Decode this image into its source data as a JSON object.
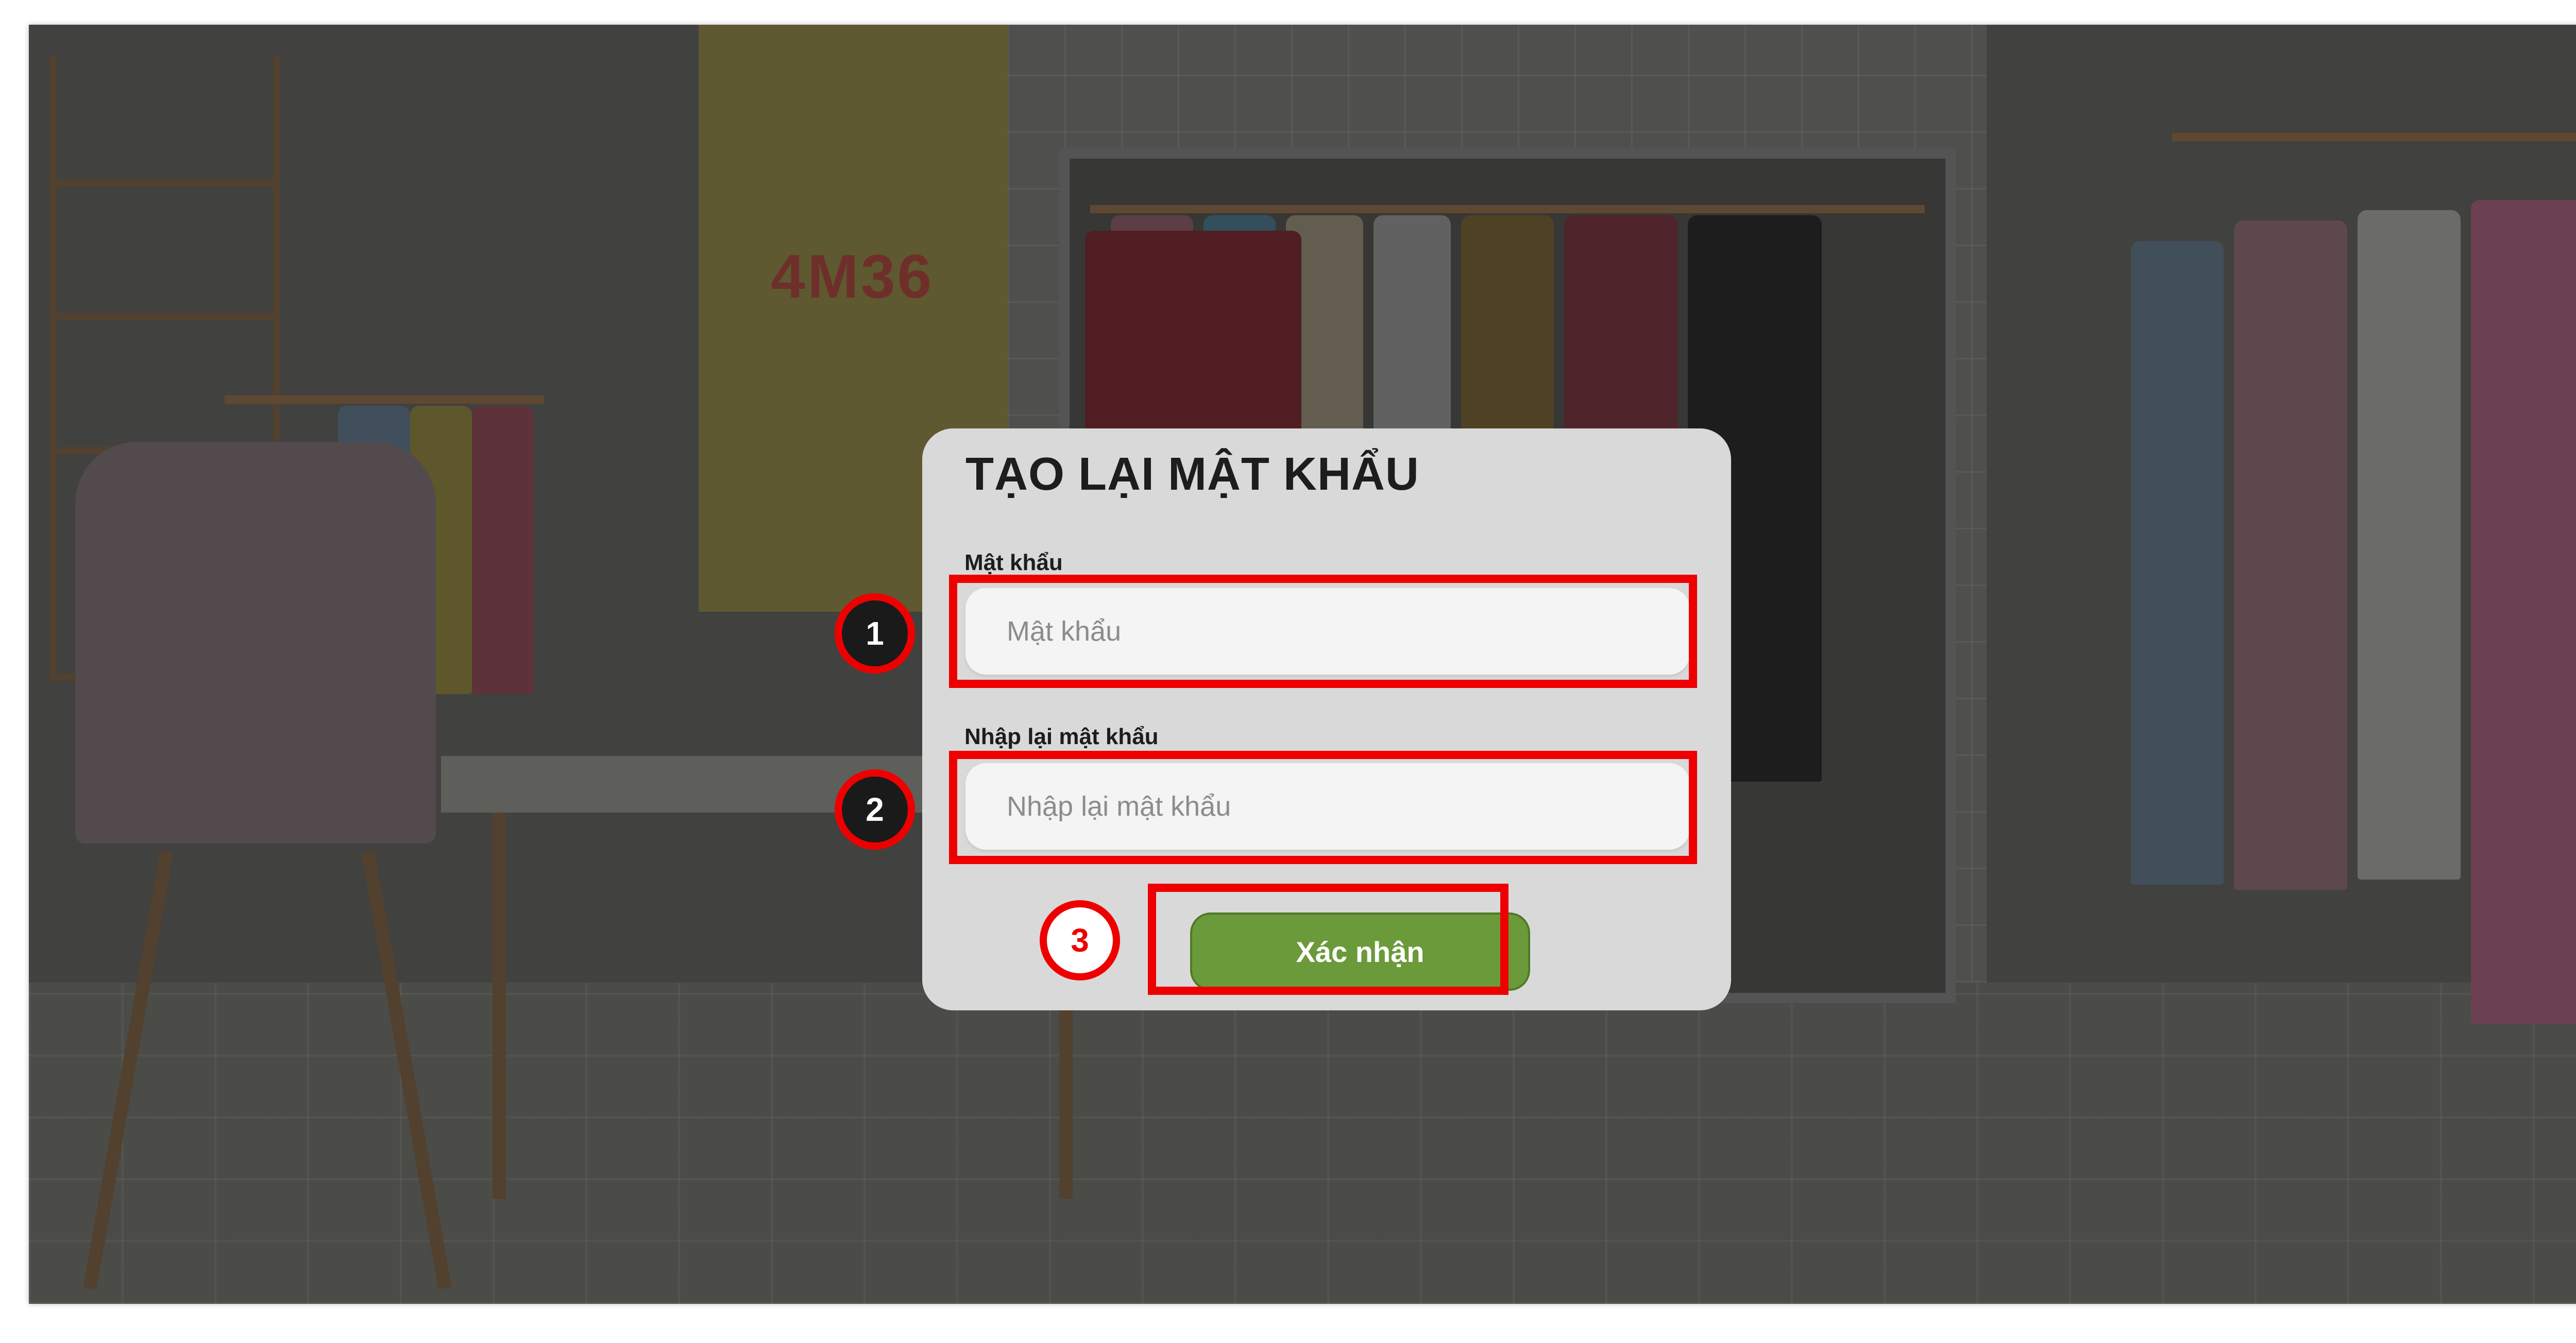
{
  "dialog": {
    "title": "TẠO LẠI MẬT KHẨU",
    "password_label": "Mật khẩu",
    "password_placeholder": "Mật khẩu",
    "password_value": "",
    "confirm_label": "Nhập lại mật khẩu",
    "confirm_placeholder": "Nhập lại mật khẩu",
    "confirm_value": "",
    "submit_button": "Xác nhận"
  },
  "annotations": {
    "step_1": "1",
    "step_2": "2",
    "step_3": "3",
    "highlight_color": "#ee0000"
  },
  "background": {
    "poster_text": "4M36"
  },
  "colors": {
    "button": "#6b9a3a",
    "dialog": "#d9d9d9"
  }
}
